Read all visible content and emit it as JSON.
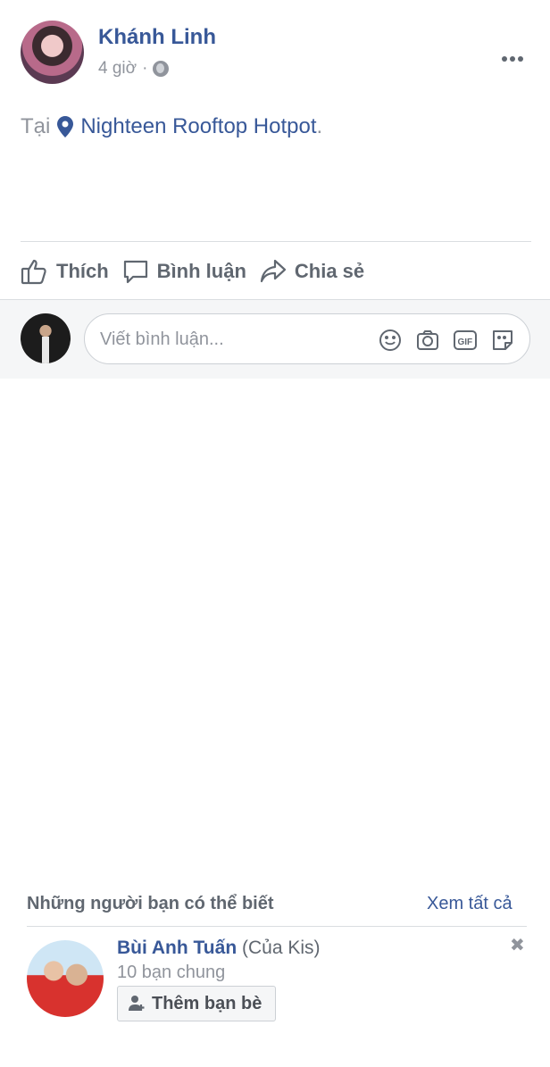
{
  "post": {
    "author": "Khánh Linh",
    "time": "4 giờ",
    "separator": "·",
    "privacy_icon": "globe-icon",
    "location_prefix": "Tại",
    "location_name": "Nighteen Rooftop Hotpot",
    "location_suffix": ".",
    "location_icon": "location-pin-icon",
    "more_icon": "more-options-icon"
  },
  "actions": {
    "like": "Thích",
    "comment": "Bình luận",
    "share": "Chia sẻ"
  },
  "comment": {
    "placeholder": "Viết bình luận...",
    "icons": [
      "emoji-icon",
      "camera-icon",
      "gif-icon",
      "sticker-icon"
    ]
  },
  "suggestions": {
    "title": "Những người bạn có thể biết",
    "see_all": "Xem tất cả",
    "friend": {
      "name": "Bùi Anh Tuấn",
      "via": "(Của Kis)",
      "mutual": "10 bạn chung",
      "add_label": "Thêm bạn bè",
      "close_icon": "close-icon"
    }
  },
  "colors": {
    "link": "#385898",
    "muted": "#90949c",
    "action": "#606770",
    "comment_bg": "#f5f6f7"
  }
}
